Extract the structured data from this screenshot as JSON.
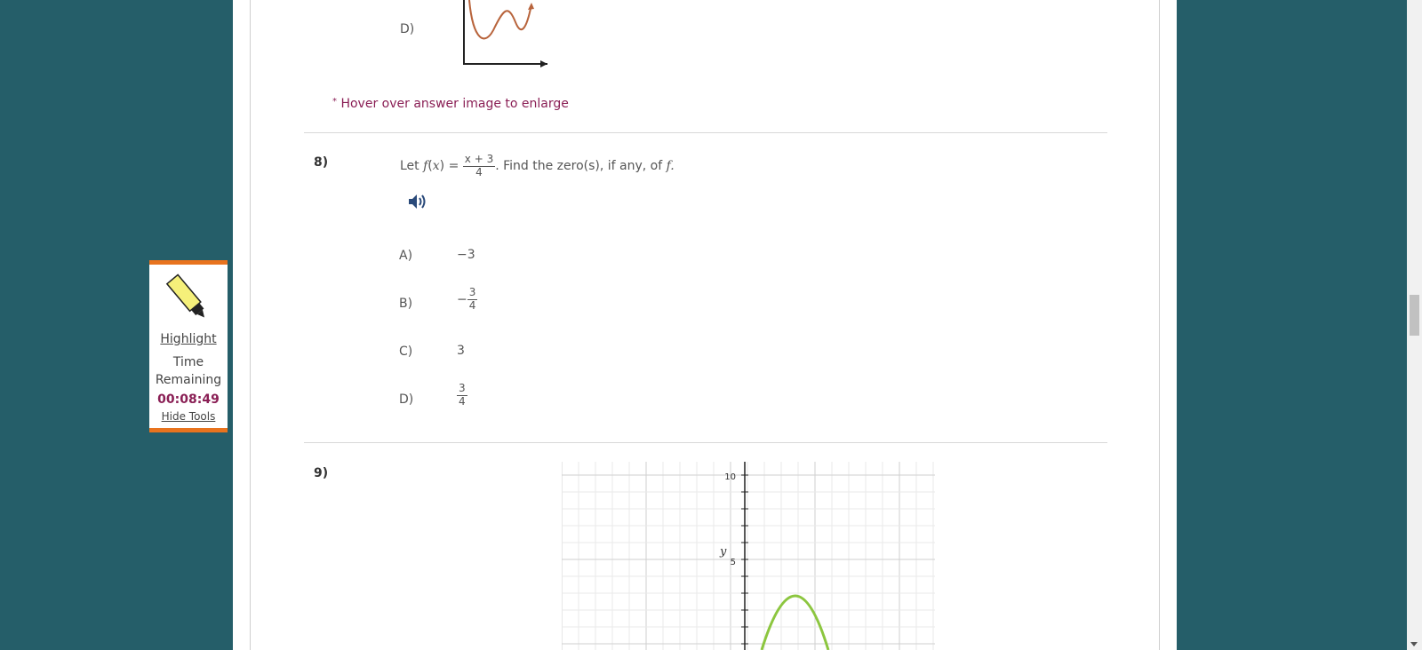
{
  "question7": {
    "choice_d_letter": "D)"
  },
  "hint": {
    "marker": "*",
    "text": "Hover over answer image to enlarge"
  },
  "question8": {
    "number": "8)",
    "prompt_prefix": "Let",
    "func": "f",
    "var": "x",
    "equals": "=",
    "frac_num": "x + 3",
    "frac_den": "4",
    "prompt_suffix": ". Find the zero(s), if any, of",
    "func_end": "f.",
    "choices": [
      {
        "letter": "A)",
        "value": "−3"
      },
      {
        "letter": "B)",
        "sign": "−",
        "num": "3",
        "den": "4"
      },
      {
        "letter": "C)",
        "value": "3"
      },
      {
        "letter": "D)",
        "num": "3",
        "den": "4"
      }
    ]
  },
  "question9": {
    "number": "9)",
    "graph": {
      "y_axis_label": "y",
      "tick_10": "10",
      "tick_5": "5"
    }
  },
  "tools": {
    "highlight": "Highlight",
    "time_label_1": "Time",
    "time_label_2": "Remaining",
    "time_value": "00:08:49",
    "hide_tools": "Hide Tools"
  },
  "colors": {
    "background": "#255e69",
    "accent_orange": "#e8731e",
    "timer": "#8a1f55",
    "curve_q7": "#b8643c",
    "curve_q9": "#8cc63f"
  }
}
